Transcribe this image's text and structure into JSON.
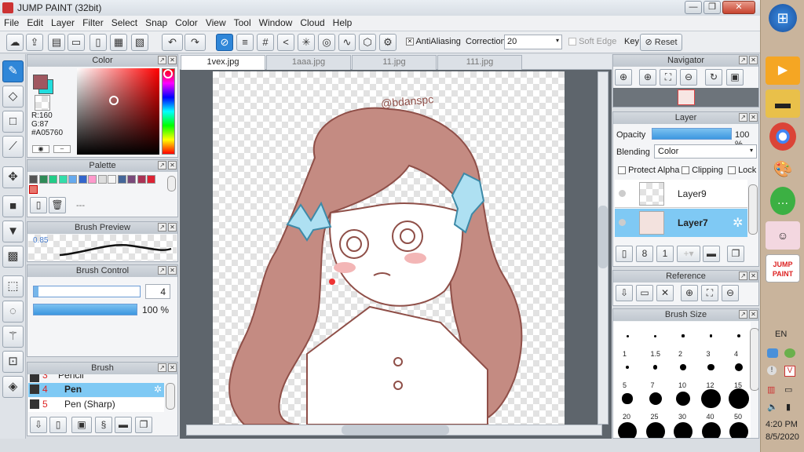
{
  "window": {
    "title": "JUMP PAINT (32bit)",
    "minimize": "—",
    "restore": "❐",
    "close": "✕"
  },
  "menu": [
    "File",
    "Edit",
    "Layer",
    "Filter",
    "Select",
    "Snap",
    "Color",
    "View",
    "Tool",
    "Window",
    "Cloud",
    "Help"
  ],
  "toolbar": {
    "antialiasing_label": "AntiAliasing",
    "correction_label": "Correction",
    "correction_value": "20",
    "soft_edge_label": "Soft Edge",
    "key_label": "Key",
    "reset_label": "Reset"
  },
  "color_panel": {
    "title": "Color",
    "r": "R:160",
    "g": "G:87",
    "hex": "#A05760",
    "color_hex": "#A05760"
  },
  "palette_panel": {
    "title": "Palette",
    "swatches": [
      "#555555",
      "#2e8b57",
      "#22cc88",
      "#33ddaa",
      "#66aaee",
      "#3366cc",
      "#ff99cc",
      "#dddddd",
      "#f5f5f5",
      "#446699",
      "#7a4a7a",
      "#aa3355",
      "#dd2233"
    ],
    "selected": "#e8776e",
    "empty_label": "---"
  },
  "brush_preview": {
    "title": "Brush Preview",
    "value": "0.85"
  },
  "brush_control": {
    "title": "Brush Control",
    "size": "4",
    "opacity": "100 %",
    "opacity_fraction": 1.0
  },
  "brush_panel": {
    "title": "Brush",
    "items": [
      {
        "num": "3",
        "name": "Pencil"
      },
      {
        "num": "4",
        "name": "Pen"
      },
      {
        "num": "5",
        "name": "Pen (Sharp)"
      }
    ]
  },
  "tabs": [
    "1vex.jpg",
    "1aaa.jpg",
    "11.jpg",
    "111.jpg"
  ],
  "canvas": {
    "watermark": "@bdanspc"
  },
  "navigator": {
    "title": "Navigator"
  },
  "layer_panel": {
    "title": "Layer",
    "opacity_label": "Opacity",
    "opacity_value": "100 %",
    "blending_label": "Blending",
    "blending_value": "Color",
    "protect_alpha": "Protect Alpha",
    "clipping": "Clipping",
    "lock": "Lock",
    "layers": [
      {
        "name": "Layer9"
      },
      {
        "name": "Layer7"
      }
    ]
  },
  "reference": {
    "title": "Reference"
  },
  "brush_size": {
    "title": "Brush Size",
    "rows": [
      [
        "1",
        "1.5",
        "2",
        "3",
        "4"
      ],
      [
        "5",
        "7",
        "10",
        "12",
        "15"
      ],
      [
        "20",
        "25",
        "30",
        "40",
        "50"
      ]
    ]
  },
  "taskbar": {
    "lang": "EN",
    "time": "4:20 PM",
    "date": "8/5/2020",
    "jp_label": "JUMP PAINT"
  }
}
